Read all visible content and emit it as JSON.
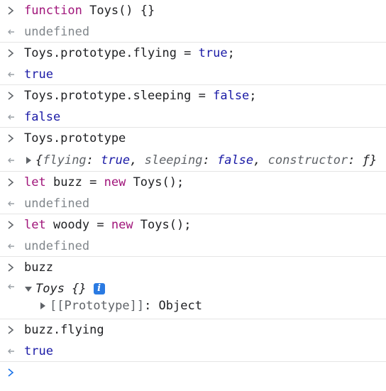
{
  "entries": [
    {
      "kind": "input",
      "text": "function Toys() {}"
    },
    {
      "kind": "output",
      "text": "undefined"
    },
    {
      "kind": "input",
      "text": "Toys.prototype.flying = true;"
    },
    {
      "kind": "output",
      "text": "true"
    },
    {
      "kind": "input",
      "text": "Toys.prototype.sleeping = false;"
    },
    {
      "kind": "output",
      "text": "false"
    },
    {
      "kind": "input",
      "text": "Toys.prototype"
    },
    {
      "kind": "output",
      "text": "{flying: true, sleeping: false, constructor: ƒ}"
    },
    {
      "kind": "input",
      "text": "let buzz = new Toys();"
    },
    {
      "kind": "output",
      "text": "undefined"
    },
    {
      "kind": "input",
      "text": "let woody = new Toys();"
    },
    {
      "kind": "output",
      "text": "undefined"
    },
    {
      "kind": "input",
      "text": "buzz"
    },
    {
      "kind": "output",
      "text": "Toys {}",
      "child": "[[Prototype]]: Object"
    },
    {
      "kind": "input",
      "text": "buzz.flying"
    },
    {
      "kind": "output",
      "text": "true"
    }
  ],
  "tokens": {
    "e0_kw": "function",
    "e0_rest": " Toys() {}",
    "e2_a": "Toys.prototype.flying = ",
    "e2_b": "true",
    "e2_c": ";",
    "e4_a": "Toys.prototype.sleeping = ",
    "e4_b": "false",
    "e4_c": ";",
    "e7_open": "{",
    "e7_k1": "flying",
    "e7_sep1": ": ",
    "e7_v1": "true",
    "e7_comma1": ", ",
    "e7_k2": "sleeping",
    "e7_sep2": ": ",
    "e7_v2": "false",
    "e7_comma2": ", ",
    "e7_k3": "constructor",
    "e7_sep3": ": ",
    "e7_v3": "ƒ",
    "e7_close": "}",
    "e8_kw": "let",
    "e8_mid": " buzz = ",
    "e8_kw2": "new",
    "e8_rest": " Toys();",
    "e10_kw": "let",
    "e10_mid": " woody = ",
    "e10_kw2": "new",
    "e10_rest": " Toys();",
    "e13_head": "Toys {}",
    "e13_info": "i",
    "e13_child_key": "[[Prototype]]",
    "e13_child_sep": ": ",
    "e13_child_val": "Object"
  },
  "icons": {
    "input_prompt": "chevron-right-icon",
    "output_marker": "return-arrow-icon",
    "expand_collapsed": "triangle-right-icon",
    "expand_open": "triangle-down-icon",
    "active_prompt": "chevron-right-icon"
  },
  "colors": {
    "keyword": "#a0157a",
    "boolean": "#1a1aa6",
    "undefined": "#80868b",
    "prompt_active": "#1a73e8",
    "info_badge": "#2a7ae2"
  }
}
